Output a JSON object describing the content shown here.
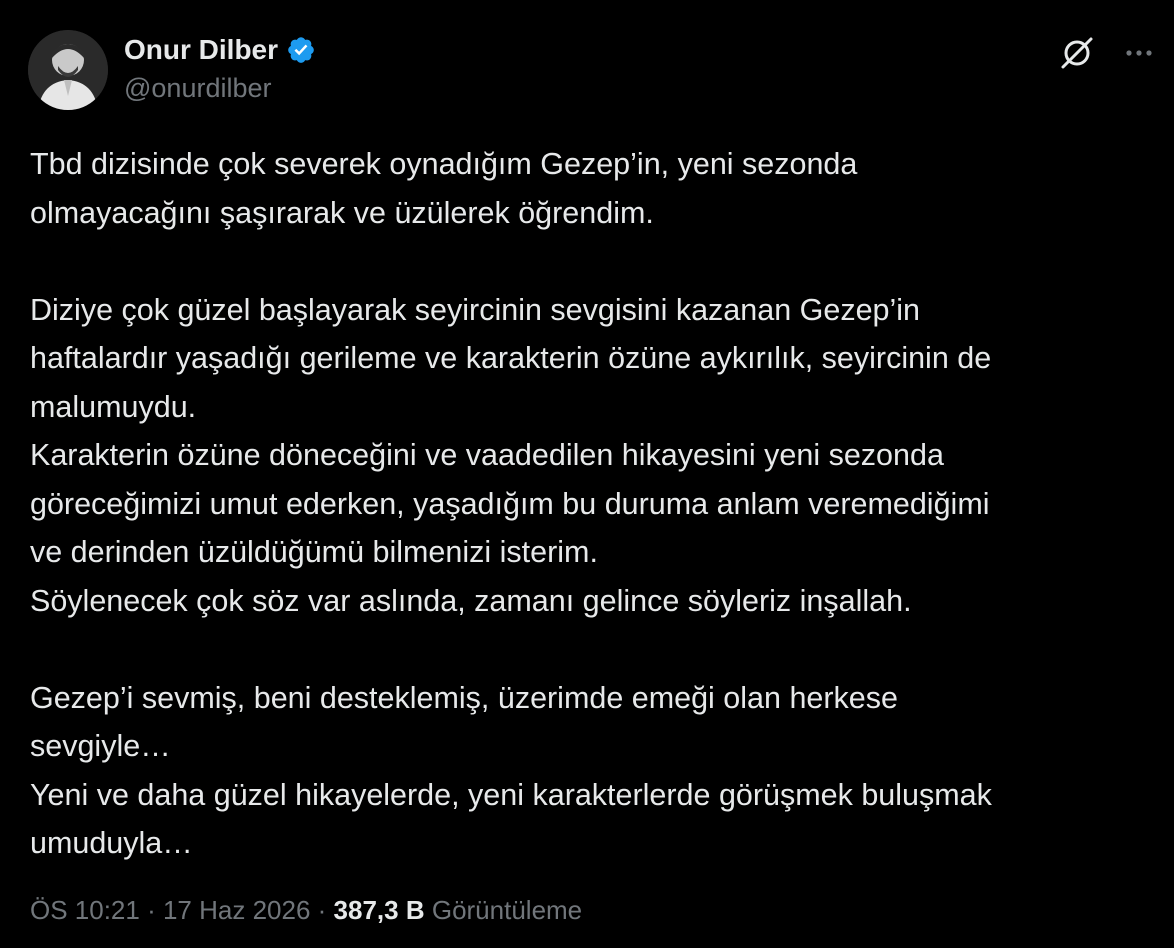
{
  "user": {
    "display_name": "Onur Dilber",
    "handle": "@onurdilber",
    "verified_color": "#1d9bf0"
  },
  "icons": {
    "verified": "verified-badge-icon",
    "grok": "grok-icon",
    "more": "more-horizontal-icon"
  },
  "tweet": {
    "lines": [
      "Tbd dizisinde çok severek oynadığım Gezep’in, yeni sezonda",
      "olmayacağını şaşırarak ve üzülerek öğrendim.",
      "",
      "Diziye çok güzel başlayarak seyircinin sevgisini kazanan Gezep’in",
      "haftalardır yaşadığı gerileme ve karakterin özüne aykırılık, seyircinin de",
      "malumuydu.",
      "Karakterin özüne döneceğini ve vaadedilen hikayesini yeni sezonda",
      "göreceğimizi umut ederken, yaşadığım bu duruma anlam veremediğimi",
      "ve derinden üzüldüğümü bilmenizi isterim.",
      "Söylenecek çok söz var aslında, zamanı gelince söyleriz inşallah.",
      "",
      "Gezep’i sevmiş, beni desteklemiş, üzerimde emeği olan herkese",
      "sevgiyle…",
      "Yeni ve daha güzel hikayelerde, yeni karakterlerde görüşmek buluşmak",
      "umuduyla…"
    ]
  },
  "meta": {
    "time": "ÖS 10:21",
    "separator": " · ",
    "date": "17 Haz 2026",
    "views_count": "387,3 B",
    "views_label": "Görüntüleme"
  }
}
